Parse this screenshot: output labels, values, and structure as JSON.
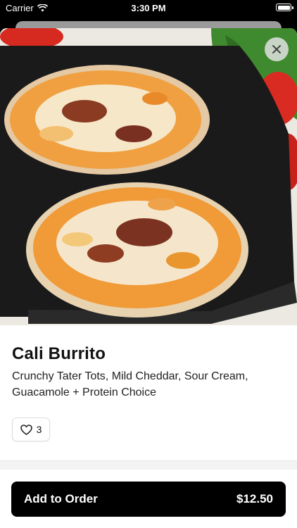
{
  "status_bar": {
    "carrier": "Carrier",
    "time": "3:30 PM",
    "wifi_icon": "wifi-icon",
    "battery_icon": "battery-icon"
  },
  "hero": {
    "image_subject": "burrito-photo",
    "close_icon": "close-icon"
  },
  "item": {
    "name": "Cali Burrito",
    "description": "Crunchy Tater Tots, Mild Cheddar, Sour Cream, Guacamole + Protein Choice",
    "likes_icon": "heart-icon",
    "likes": "3"
  },
  "order": {
    "label": "Add to Order",
    "price": "$12.50"
  },
  "colors": {
    "button": "#000000",
    "button_text": "#ffffff",
    "text": "#111111",
    "divider": "#f3f3f3"
  }
}
